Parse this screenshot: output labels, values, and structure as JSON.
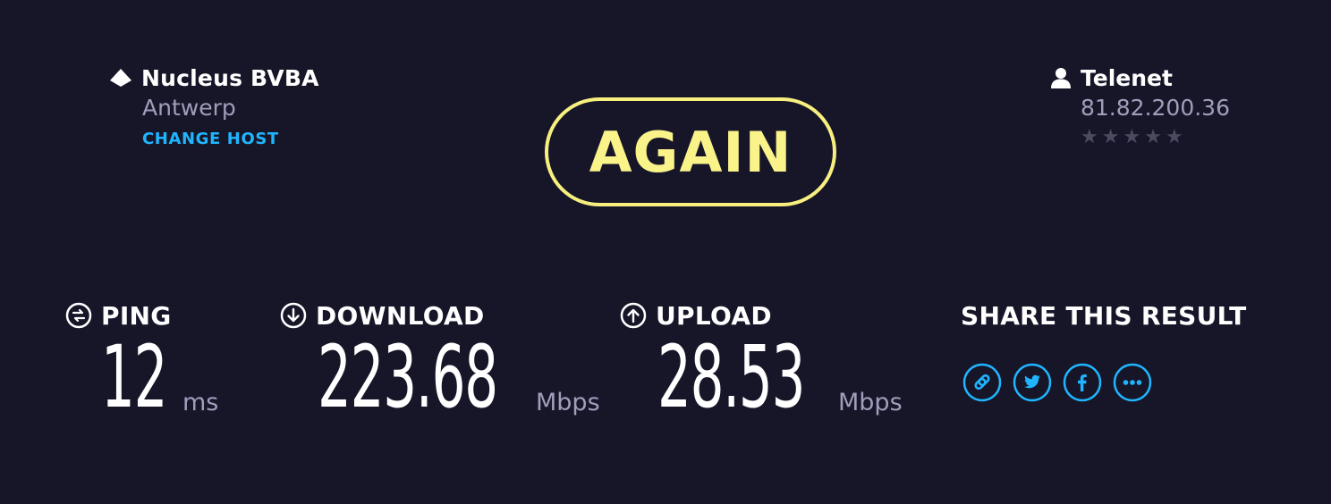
{
  "host": {
    "name": "Nucleus BVBA",
    "city": "Antwerp",
    "change_label": "CHANGE HOST",
    "icon": "host-icon"
  },
  "isp": {
    "name": "Telenet",
    "ip": "81.82.200.36",
    "rating": 0,
    "rating_max": 5,
    "icon": "user-icon"
  },
  "again": {
    "label": "AGAIN"
  },
  "metrics": {
    "ping": {
      "title": "PING",
      "value": "12",
      "unit": "ms",
      "icon": "ping-icon"
    },
    "download": {
      "title": "DOWNLOAD",
      "value": "223.68",
      "unit": "Mbps",
      "icon": "download-arrow-icon"
    },
    "upload": {
      "title": "UPLOAD",
      "value": "28.53",
      "unit": "Mbps",
      "icon": "upload-arrow-icon"
    }
  },
  "share": {
    "title": "SHARE THIS RESULT",
    "buttons": [
      "link-icon",
      "twitter-icon",
      "facebook-icon",
      "more-icon"
    ]
  },
  "colors": {
    "background": "#171629",
    "accent_yellow": "#f7f07f",
    "accent_blue": "#1fb6ff",
    "muted_text": "#9f9ebb",
    "star_inactive": "#4b4a60"
  }
}
